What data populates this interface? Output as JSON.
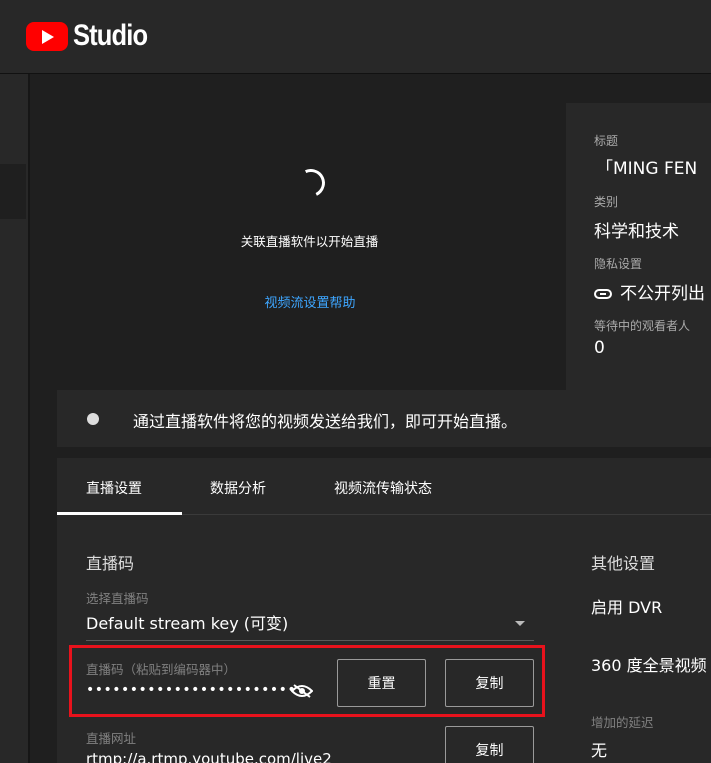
{
  "header": {
    "logo_text": "Studio"
  },
  "preview": {
    "message": "关联直播软件以开始直播",
    "help_link": "视频流设置帮助"
  },
  "info": {
    "title_label": "标题",
    "title_value": "「MING FEN",
    "category_label": "类别",
    "category_value": "科学和技术",
    "privacy_label": "隐私设置",
    "privacy_value": "不公开列出",
    "waiting_label": "等待中的观看者人",
    "waiting_value": "0"
  },
  "status": {
    "text": "通过直播软件将您的视频发送给我们，即可开始直播。"
  },
  "tabs": [
    "直播设置",
    "数据分析",
    "视频流传输状态"
  ],
  "stream": {
    "section_title": "直播码",
    "select_label": "选择直播码",
    "select_value": "Default stream key (可变)",
    "key_label": "直播码（粘贴到编码器中）",
    "key_value": "••••••••••••••••••••••••",
    "reset_button": "重置",
    "copy_button": "复制",
    "url_label": "直播网址",
    "url_value": "rtmp://a.rtmp.youtube.com/live2",
    "url_copy_button": "复制"
  },
  "other": {
    "title": "其他设置",
    "dvr": "启用 DVR",
    "vr360": "360 度全景视频",
    "latency_label": "增加的延迟",
    "latency_value": "无"
  },
  "colors": {
    "accent_link": "#3ea6ff",
    "brand_red": "#ff0000",
    "highlight_box": "#e8121c"
  }
}
